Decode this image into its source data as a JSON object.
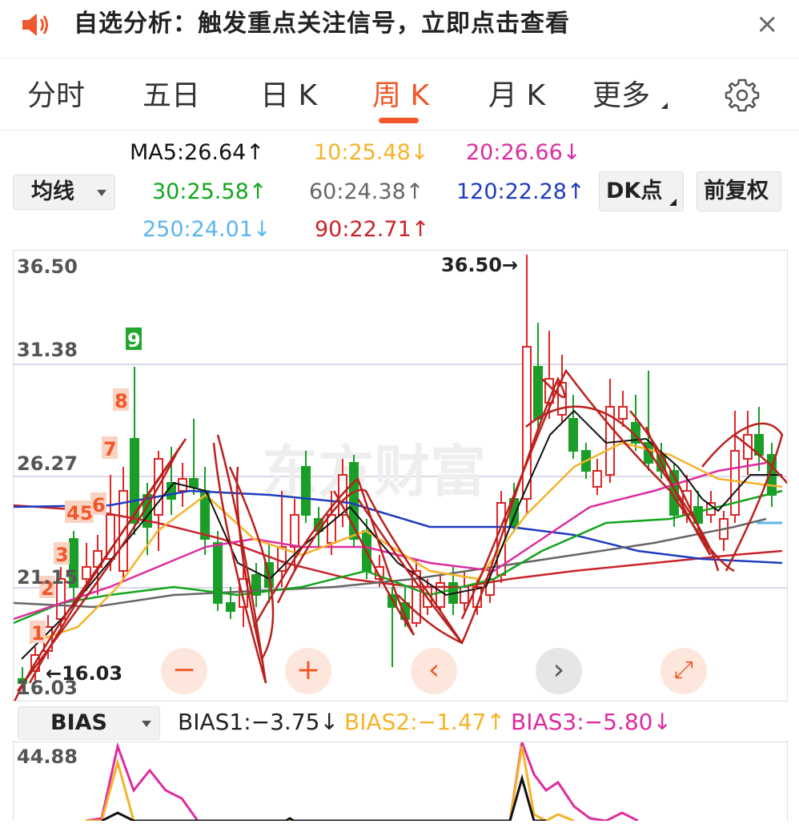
{
  "banner": {
    "text": "自选分析：触发重点关注信号，立即点击查看",
    "close": "×"
  },
  "tabs": [
    {
      "label": "分时"
    },
    {
      "label": "五日"
    },
    {
      "label": "日 K"
    },
    {
      "label": "周 K",
      "active": true
    },
    {
      "label": "月 K"
    },
    {
      "label": "更多"
    }
  ],
  "ma_selector": "均线",
  "dk_button": "DK点",
  "adjust_button": "前复权",
  "ma": {
    "ma5": "MA5:26.64↑",
    "ma10": "10:25.48↓",
    "ma20": "20:26.66↓",
    "ma30": "30:25.58↑",
    "ma60": "60:24.38↑",
    "ma120": "120:22.28↑",
    "ma250": "250:24.01↓",
    "ma90": "90:22.71↑"
  },
  "colors": {
    "accent": "#f0582b",
    "up": "#e02525",
    "down": "#1a9e27",
    "ma5": "#111111",
    "ma10": "#f5b32a",
    "ma20": "#dd2ca0",
    "ma30": "#14a51e",
    "ma60": "#666666",
    "ma120": "#1f3bbf",
    "ma250": "#5bb6ee",
    "ma90": "#c9242a"
  },
  "chart": {
    "y_labels": [
      "36.50",
      "31.38",
      "26.27",
      "21.15",
      "16.03"
    ],
    "high_label": "36.50→",
    "low_label": "←16.03",
    "td_counts": [
      "1",
      "2",
      "3",
      "45",
      "6",
      "7",
      "8",
      "9"
    ],
    "watermark": "东方财富"
  },
  "controls": {
    "zoom_out": "−",
    "zoom_in": "+",
    "prev": "‹",
    "next": "›",
    "fullscreen": "⤢"
  },
  "bias": {
    "selector": "BIAS",
    "bias1": "BIAS1:−3.75↓",
    "bias2": "BIAS2:−1.47↑",
    "bias3": "BIAS3:−5.80↓",
    "y_label": "44.88"
  }
}
